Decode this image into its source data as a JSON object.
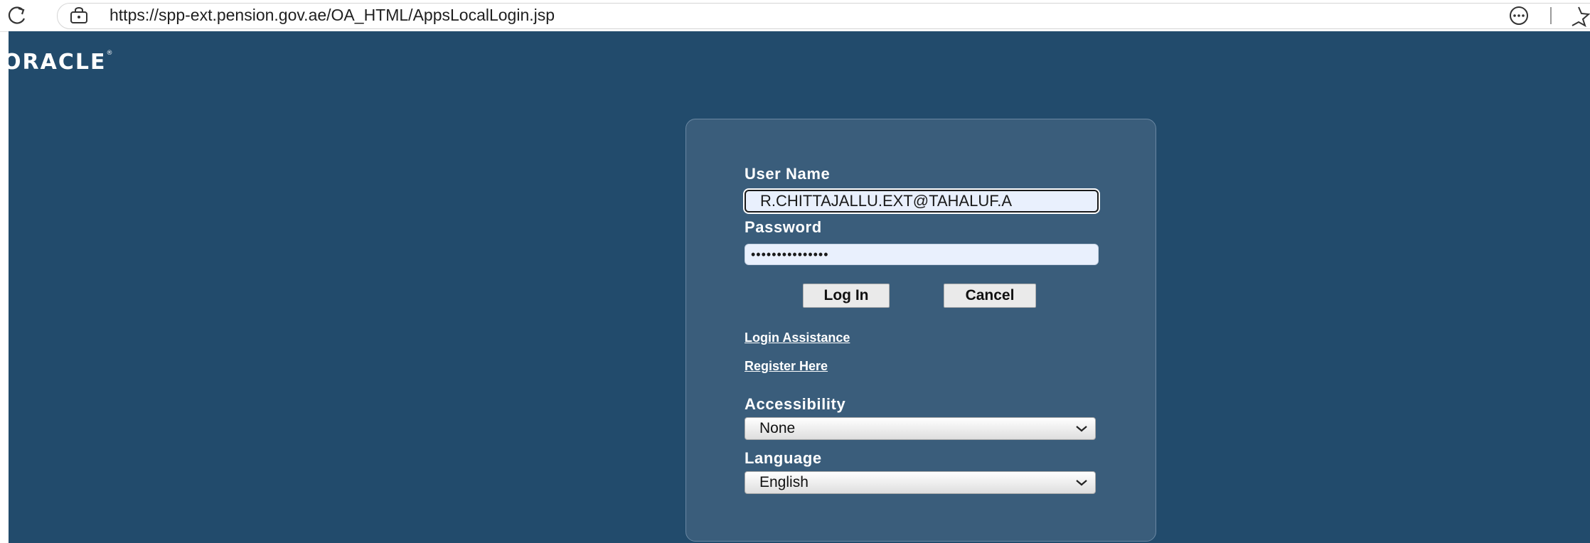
{
  "browser": {
    "url": "https://spp-ext.pension.gov.ae/OA_HTML/AppsLocalLogin.jsp"
  },
  "header": {
    "logo_text": "ORACLE"
  },
  "login": {
    "username_label": "User Name",
    "username_value": "R.CHITTAJALLU.EXT@TAHALUF.A",
    "password_label": "Password",
    "password_value": "•••••••••••••••",
    "login_button": "Log In",
    "cancel_button": "Cancel",
    "login_assistance_link": "Login Assistance",
    "register_link": "Register Here",
    "accessibility_label": "Accessibility",
    "accessibility_value": "None",
    "language_label": "Language",
    "language_value": "English"
  },
  "icons": {
    "reload": "reload-icon",
    "site_info": "site-info-icon",
    "more": "more-options-icon",
    "favorite": "favorite-icon",
    "dropdown": "chevron-down-icon"
  },
  "colors": {
    "page_background": "#224b6c",
    "panel_background": "#3a5d7b",
    "input_background": "#e9f0fd"
  }
}
